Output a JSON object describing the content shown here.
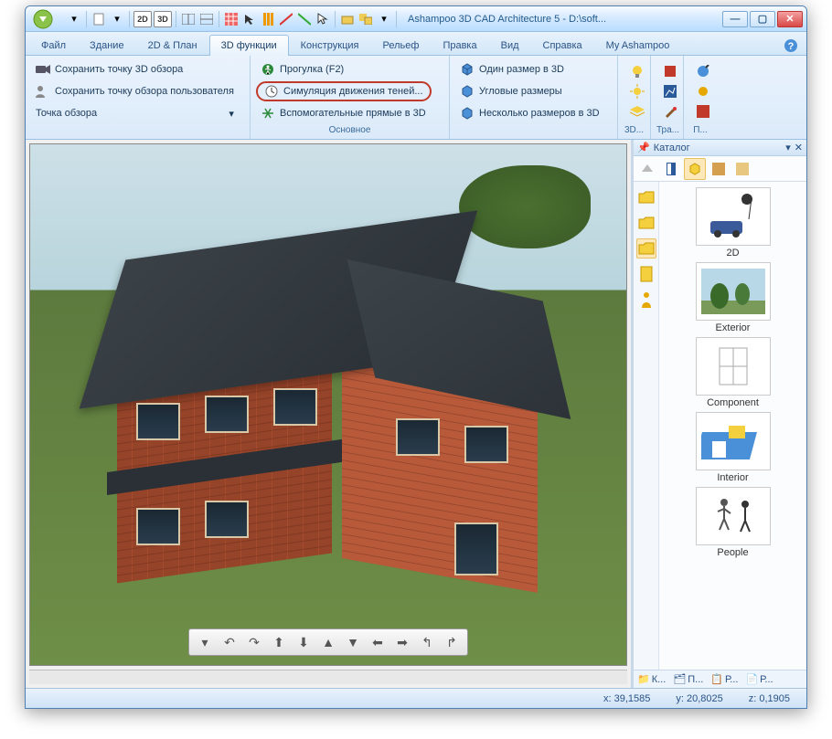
{
  "window": {
    "title": "Ashampoo 3D CAD Architecture 5 - D:\\soft..."
  },
  "qat_icons": [
    "dropdown",
    "sep",
    "new",
    "open",
    "sep",
    "2d",
    "3d",
    "sep",
    "views",
    "panes",
    "sep",
    "grid",
    "cursor",
    "rulers",
    "snap",
    "snap2",
    "select",
    "sep",
    "shape",
    "group",
    "ungroup",
    "sep"
  ],
  "tabs": {
    "items": [
      "Файл",
      "Здание",
      "2D & План",
      "3D функции",
      "Конструкция",
      "Рельеф",
      "Правка",
      "Вид",
      "Справка",
      "My Ashampoo"
    ],
    "active_index": 3
  },
  "ribbon": {
    "group1": {
      "btn1": "Сохранить точку 3D обзора",
      "btn2": "Сохранить точку обзора пользователя",
      "btn3": "Точка обзора"
    },
    "group2": {
      "btn1": "Прогулка (F2)",
      "btn2": "Симуляция движения теней...",
      "btn3": "Вспомогательные прямые в 3D",
      "label": "Основное"
    },
    "group3": {
      "btn1": "Один размер в 3D",
      "btn2": "Угловые размеры",
      "btn3": "Несколько размеров в 3D"
    },
    "group_small": {
      "l1": "3D...",
      "l2": "Тра...",
      "l3": "П..."
    }
  },
  "catalog": {
    "title": "Каталог",
    "items": [
      {
        "label": "2D"
      },
      {
        "label": "Exterior"
      },
      {
        "label": "Component"
      },
      {
        "label": "Interior"
      },
      {
        "label": "People"
      }
    ],
    "bottom_tabs": [
      "К...",
      "П...",
      "Р...",
      "Р..."
    ]
  },
  "statusbar": {
    "x": "x: 39,1585",
    "y": "y: 20,8025",
    "z": "z: 0,1905"
  },
  "colors": {
    "accent": "#2a5385",
    "highlight": "#c0392b"
  }
}
